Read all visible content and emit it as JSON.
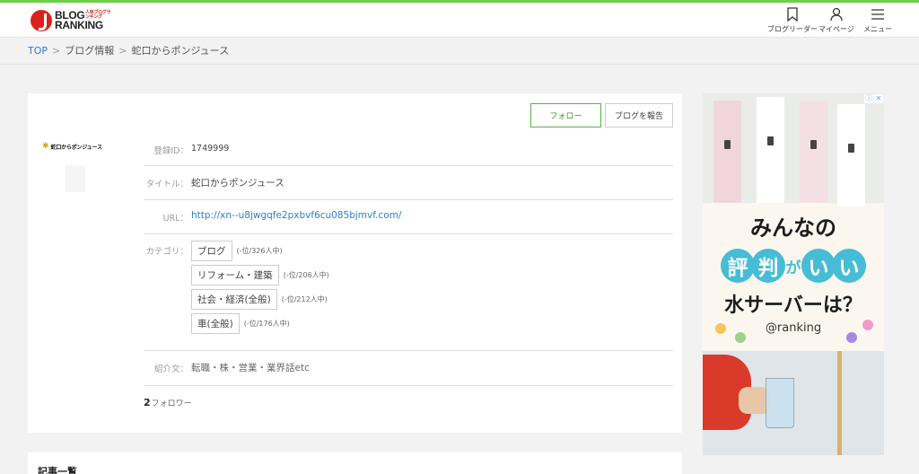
{
  "header": {
    "logo_line1": "BLOG",
    "logo_line2": "RANKING",
    "logo_sub": "人気ブログランキング",
    "nav": [
      {
        "label": "ブログリーダー",
        "icon": "bookmark-icon"
      },
      {
        "label": "マイページ",
        "icon": "user-icon"
      },
      {
        "label": "メニュー",
        "icon": "hamburger-menu-icon"
      }
    ]
  },
  "breadcrumb": {
    "home": "TOP",
    "sep": ">",
    "level2": "ブログ情報",
    "current": "蛇口からポンジュース"
  },
  "profile": {
    "follow_label": "フォロー",
    "report_label": "ブログを報告",
    "thumb_text": "蛇口からポンジュース",
    "id_label": "登録ID：",
    "id_value": "1749999",
    "title_label": "タイトル：",
    "title_value": "蛇口からポンジュース",
    "url_label": "URL：",
    "url_value": "http://xn--u8jwgqfe2pxbvf6cu085bjmvf.com/",
    "category_label": "カテゴリ：",
    "categories": [
      {
        "name": "ブログ",
        "rank": "(-位/326人中)"
      },
      {
        "name": "リフォーム・建築",
        "rank": "(-位/206人中)"
      },
      {
        "name": "社会・経済(全般)",
        "rank": "(-位/212人中)"
      },
      {
        "name": "車(全般)",
        "rank": "(-位/176人中)"
      }
    ],
    "intro_label": "紹介文：",
    "intro_value": "転職・株・営業・業界話etc",
    "follower_count": "2",
    "follower_label": "フォロワー"
  },
  "articles": {
    "heading": "記事一覧"
  },
  "ad": {
    "line1": "みんなの",
    "bubbles": [
      "評",
      "判",
      "が",
      "い",
      "い"
    ],
    "line3": "水サーバーは？",
    "brand": "@ranking",
    "info_icon": "info-icon",
    "close_icon": "close-icon"
  },
  "colors": {
    "accent_green": "#6fcf4b",
    "link_blue": "#2a7fd0",
    "brand_red": "#d9221c",
    "ad_teal": "#46bdd4"
  }
}
